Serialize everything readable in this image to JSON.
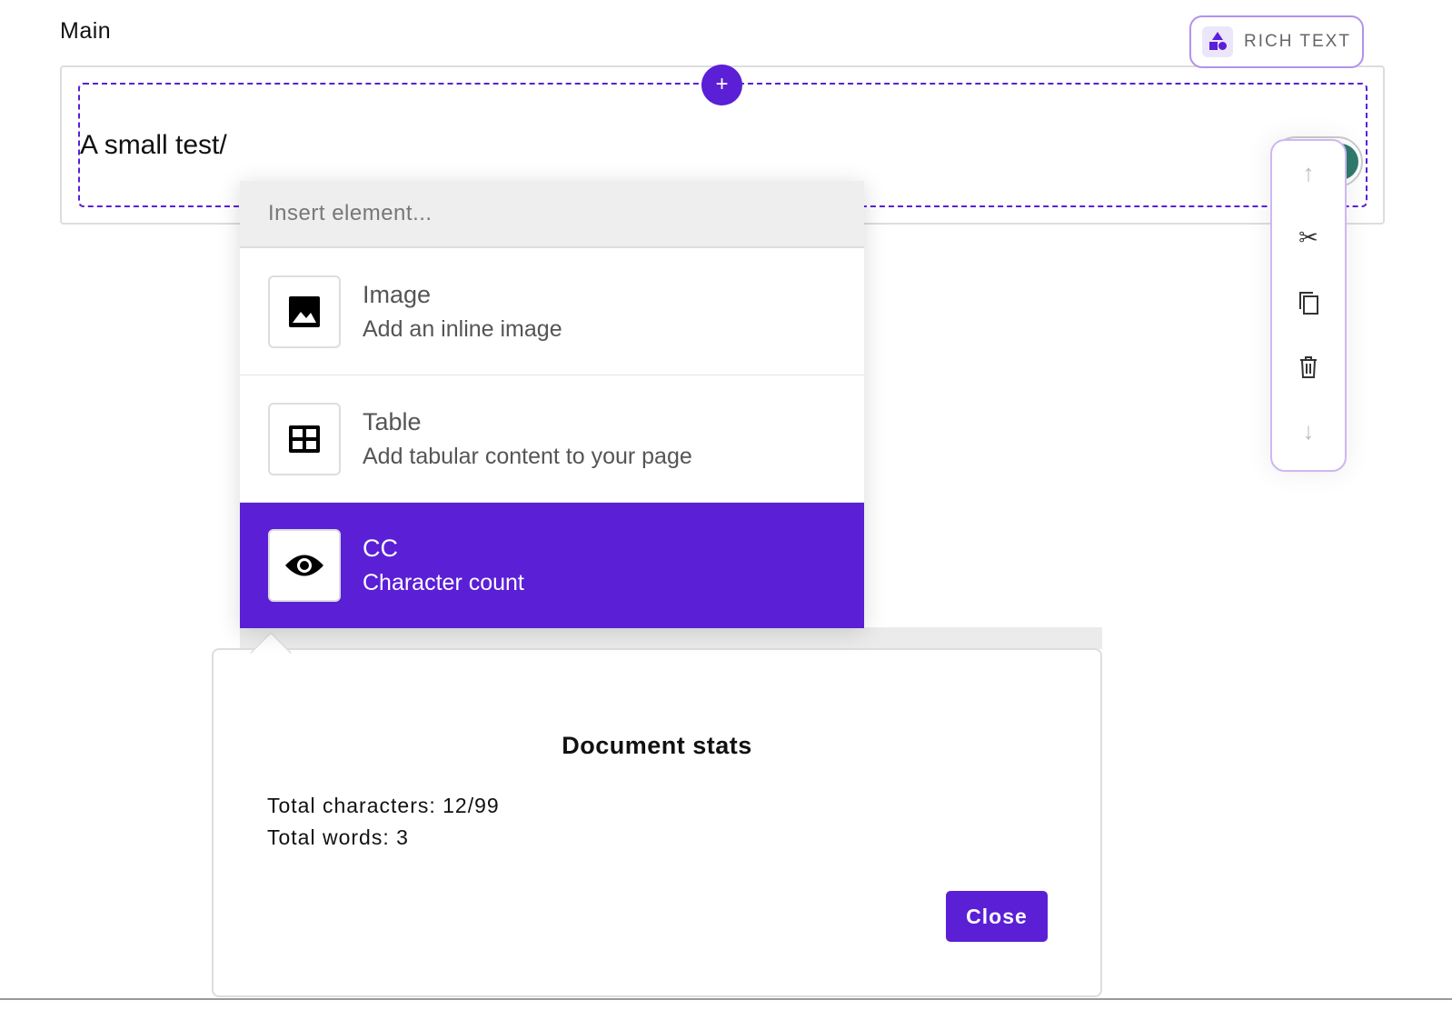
{
  "field": {
    "label": "Main",
    "type_badge": "RICH TEXT",
    "content": "A small test/"
  },
  "insert_menu": {
    "placeholder": "Insert element...",
    "items": [
      {
        "title": "Image",
        "description": "Add an inline image",
        "icon": "image-icon"
      },
      {
        "title": "Table",
        "description": "Add tabular content to your page",
        "icon": "table-icon"
      },
      {
        "title": "CC",
        "description": "Character count",
        "icon": "eye-icon",
        "selected": true
      }
    ]
  },
  "stats": {
    "title": "Document stats",
    "characters": "Total characters: 12/99",
    "words": "Total words: 3",
    "close_label": "Close"
  },
  "colors": {
    "accent": "#5b1fd6"
  }
}
